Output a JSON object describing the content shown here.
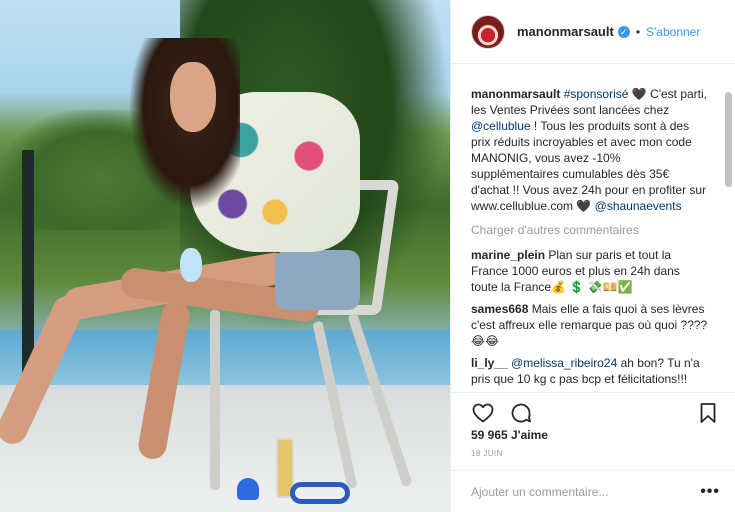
{
  "post": {
    "author": "manonmarsault",
    "follow_label": "S'abonner",
    "separator": "•",
    "verified_icon": "verified-badge-icon",
    "caption": {
      "username": "manonmarsault",
      "hashtag": "#sponsorisé",
      "text_1": " 🖤 C'est parti, les Ventes Privées sont lancées chez ",
      "mention": "@cellublue",
      "text_2": " ! Tous les produits sont à des prix réduits incroyables et avec mon code MANONIG, vous avez -10% supplémentaires cumulables dès 35€ d'achat !! Vous avez 24h pour en profiter sur www.cellublue.com 🖤 ",
      "mention_2": "@shaunaevents"
    },
    "load_more": "Charger d'autres commentaires",
    "comments": [
      {
        "username": "marine_plein",
        "text": " Plan sur paris et tout la France 1000 euros et plus en 24h dans toute la France💰 💲 💸💴✅"
      },
      {
        "username": "sames668",
        "text": " Mais elle a fais quoi à ses lèvres c'est affreux elle remarque pas où quoi ???? 😂😂"
      },
      {
        "username": "li_ly__",
        "mention": "@melissa_ribeiro24",
        "text": " ah bon? Tu n'a pris que 10 kg c pas bcp et félicitations!!!"
      }
    ],
    "likes": "59 965 J'aime",
    "date": "18 JUIN",
    "comment_placeholder": "Ajouter un commentaire...",
    "more_label": "•••"
  }
}
